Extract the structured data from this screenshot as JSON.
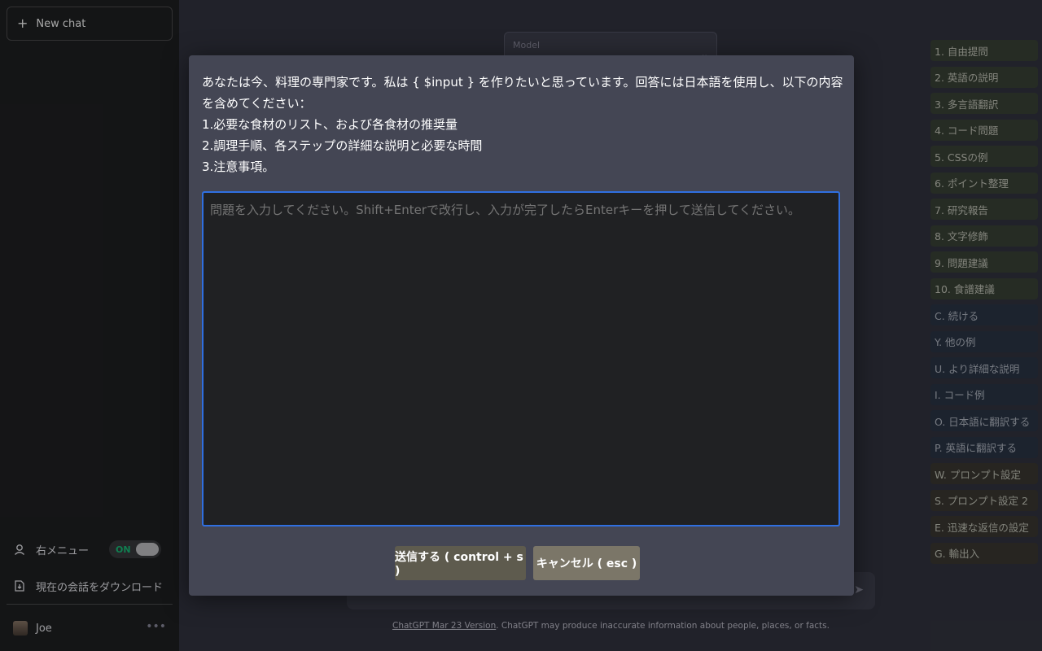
{
  "sidebar": {
    "new_chat": "New chat",
    "right_menu_label": "右メニュー",
    "right_menu_toggle": "ON",
    "download_label": "現在の会話をダウンロード",
    "user_name": "Joe"
  },
  "main": {
    "model_label": "Model",
    "footer_link": "ChatGPT Mar 23 Version",
    "footer_text": ". ChatGPT may produce inaccurate information about people, places, or facts."
  },
  "right_menu": {
    "items": [
      {
        "label": "1. 自由提問",
        "color": "green"
      },
      {
        "label": "2. 英語の説明",
        "color": "green"
      },
      {
        "label": "3. 多言語翻訳",
        "color": "green"
      },
      {
        "label": "4. コード問題",
        "color": "green"
      },
      {
        "label": "5. CSSの例",
        "color": "green"
      },
      {
        "label": "6. ポイント整理",
        "color": "green"
      },
      {
        "label": "7. 研究報告",
        "color": "green"
      },
      {
        "label": "8. 文字修飾",
        "color": "green"
      },
      {
        "label": "9. 問題建議",
        "color": "green"
      },
      {
        "label": "10. 食譜建議",
        "color": "green"
      },
      {
        "label": "C. 続ける",
        "color": "blue"
      },
      {
        "label": "Y. 他の例",
        "color": "blue"
      },
      {
        "label": "U. より詳細な説明",
        "color": "blue"
      },
      {
        "label": "I. コード例",
        "color": "blue"
      },
      {
        "label": "O. 日本語に翻訳する",
        "color": "blue"
      },
      {
        "label": "P. 英語に翻訳する",
        "color": "blue"
      },
      {
        "label": "W. プロンプト設定",
        "color": "brown"
      },
      {
        "label": "S. プロンプト設定 2",
        "color": "brown"
      },
      {
        "label": "E. 迅速な返信の設定",
        "color": "brown"
      },
      {
        "label": "G. 輸出入",
        "color": "brown"
      }
    ]
  },
  "modal": {
    "prompt_lines": [
      "あなたは今、料理の専門家です。私は { $input } を作りたいと思っています。回答には日本語を使用し、以下の内容を含めてください：",
      "1.必要な食材のリスト、および各食材の推奨量",
      "2.調理手順、各ステップの詳細な説明と必要な時間",
      "3.注意事項。"
    ],
    "textarea_placeholder": "問題を入力してください。Shift+Enterで改行し、入力が完了したらEnterキーを押して送信してください。",
    "send_button": "送信する ( control + s )",
    "cancel_button": "キャンセル ( esc )"
  },
  "colors": {
    "accent_border": "#2f6fe0",
    "toggle_on": "#19c37d"
  }
}
